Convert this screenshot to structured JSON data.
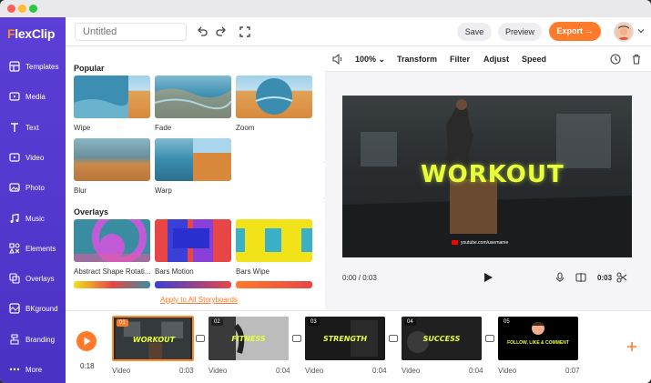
{
  "app": {
    "logo_text": "lexClip",
    "logo_first": "F"
  },
  "sidebar": {
    "items": [
      {
        "label": "Templates",
        "icon": "templates-icon"
      },
      {
        "label": "Media",
        "icon": "media-icon"
      },
      {
        "label": "Text",
        "icon": "text-icon"
      },
      {
        "label": "Video",
        "icon": "video-icon"
      },
      {
        "label": "Photo",
        "icon": "photo-icon"
      },
      {
        "label": "Music",
        "icon": "music-icon"
      },
      {
        "label": "Elements",
        "icon": "elements-icon"
      },
      {
        "label": "Overlays",
        "icon": "overlays-icon"
      },
      {
        "label": "BKground",
        "icon": "background-icon"
      },
      {
        "label": "Branding",
        "icon": "branding-icon"
      },
      {
        "label": "More",
        "icon": "more-icon"
      }
    ]
  },
  "topbar": {
    "title_placeholder": "Untitled",
    "save_label": "Save",
    "preview_label": "Preview",
    "export_label": "Export →"
  },
  "panel": {
    "popular_title": "Popular",
    "overlays_title": "Overlays",
    "popular": [
      {
        "label": "Wipe"
      },
      {
        "label": "Fade"
      },
      {
        "label": "Zoom"
      },
      {
        "label": "Blur"
      },
      {
        "label": "Warp"
      }
    ],
    "overlays": [
      {
        "label": "Abstract Shape Rotati..."
      },
      {
        "label": "Bars Motion"
      },
      {
        "label": "Bars Wipe"
      }
    ],
    "apply_all": "Apply to All Storyboards"
  },
  "preview_toolbar": {
    "zoom": "100%",
    "transform": "Transform",
    "filter": "Filter",
    "adjust": "Adjust",
    "speed": "Speed"
  },
  "preview": {
    "video_title": "WORKOUT",
    "youtube_handle": "youtube.com/username",
    "time_current": "0:00 / 0:03",
    "duration": "0:03"
  },
  "timeline": {
    "total_time": "0:18",
    "clips": [
      {
        "num": "01",
        "title": "WORKOUT",
        "type": "Video",
        "duration": "0:03"
      },
      {
        "num": "02",
        "title": "FITNESS",
        "type": "Video",
        "duration": "0:04"
      },
      {
        "num": "03",
        "title": "STRENGTH",
        "type": "Video",
        "duration": "0:04"
      },
      {
        "num": "04",
        "title": "SUCCESS",
        "type": "Video",
        "duration": "0:04"
      },
      {
        "num": "05",
        "title": "FOLLOW, LIKE & COMMENT",
        "type": "Video",
        "duration": "0:07"
      }
    ]
  },
  "colors": {
    "accent": "#ff7a2a",
    "sidebar": "#5b3fd6",
    "highlight_text": "#e9ff3a"
  }
}
